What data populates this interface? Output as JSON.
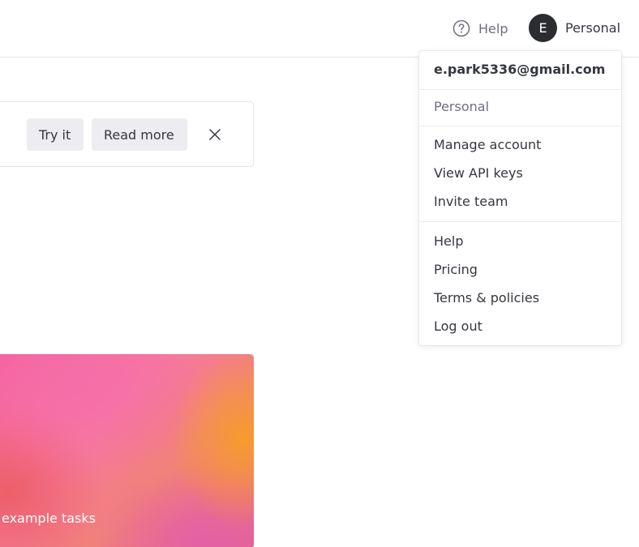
{
  "header": {
    "help_label": "Help",
    "account": {
      "avatar_initial": "E",
      "label": "Personal"
    }
  },
  "banner": {
    "try_label": "Try it",
    "read_more_label": "Read more"
  },
  "card": {
    "text": "example tasks"
  },
  "account_menu": {
    "email": "e.park5336@gmail.com",
    "org_name": "Personal",
    "account_items": [
      {
        "label": "Manage account"
      },
      {
        "label": "View API keys"
      },
      {
        "label": "Invite team"
      }
    ],
    "general_items": [
      {
        "label": "Help"
      },
      {
        "label": "Pricing"
      },
      {
        "label": "Terms & policies"
      },
      {
        "label": "Log out"
      }
    ]
  },
  "icons": {
    "help": "question-circle-icon",
    "close": "close-icon"
  },
  "colors": {
    "avatar_bg": "#2b2d31",
    "button_bg": "#ececf1",
    "muted_text": "#6e6e80",
    "text": "#353740"
  }
}
